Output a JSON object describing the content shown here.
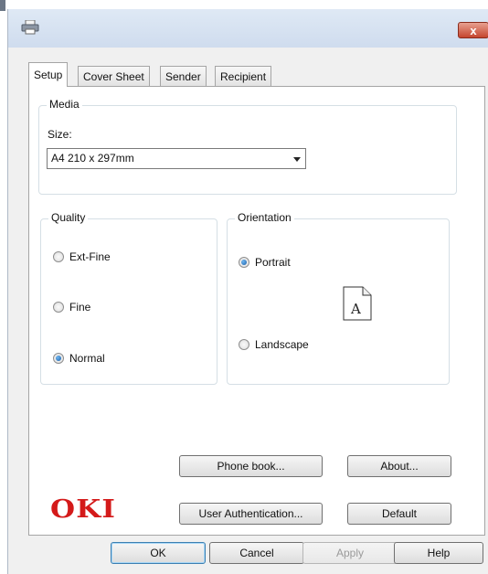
{
  "window": {
    "close_glyph": "x",
    "icon": "printer-icon"
  },
  "tabs": [
    {
      "label": "Setup",
      "active": true
    },
    {
      "label": "Cover Sheet",
      "active": false
    },
    {
      "label": "Sender",
      "active": false
    },
    {
      "label": "Recipient",
      "active": false
    }
  ],
  "media": {
    "legend": "Media",
    "size_label": "Size:",
    "size_value": "A4 210 x 297mm"
  },
  "quality": {
    "legend": "Quality",
    "options": [
      {
        "label": "Ext-Fine",
        "checked": false
      },
      {
        "label": "Fine",
        "checked": false
      },
      {
        "label": "Normal",
        "checked": true
      }
    ]
  },
  "orientation": {
    "legend": "Orientation",
    "options": [
      {
        "label": "Portrait",
        "checked": true
      },
      {
        "label": "Landscape",
        "checked": false
      }
    ],
    "preview_letter": "A"
  },
  "panel_buttons": {
    "phone_book": "Phone book...",
    "about": "About...",
    "user_auth": "User Authentication...",
    "default": "Default"
  },
  "logo_text": "OKI",
  "footer_buttons": {
    "ok": "OK",
    "cancel": "Cancel",
    "apply": "Apply",
    "help": "Help"
  },
  "colors": {
    "logo": "#d41a1a",
    "close": "#c5452f",
    "titlebar": "#cfdcee"
  }
}
